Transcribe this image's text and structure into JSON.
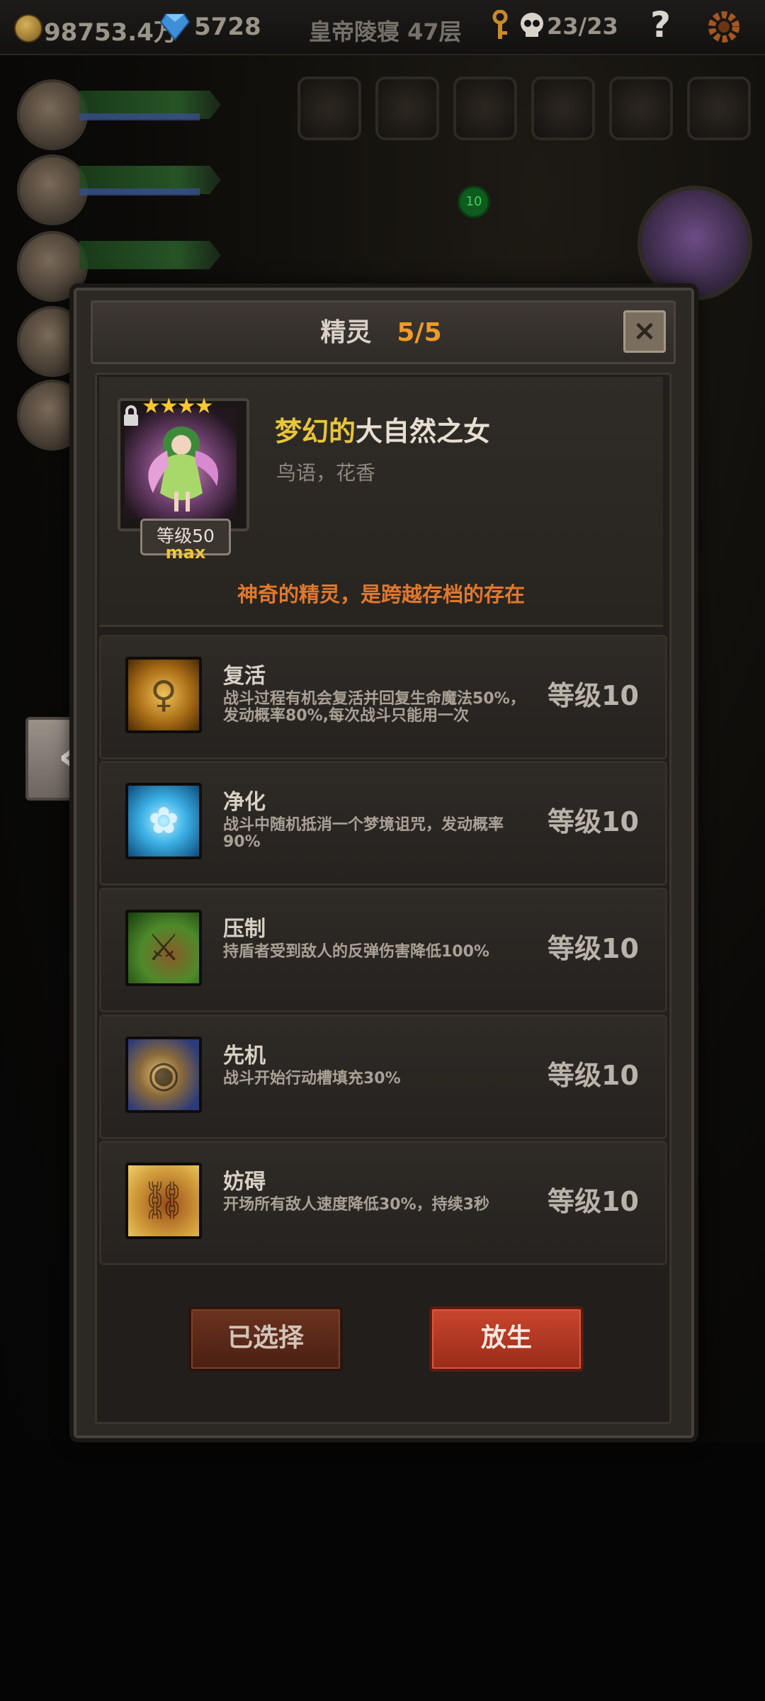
{
  "topbar": {
    "gold": "98753.4万",
    "gems": "5728",
    "location": "皇帝陵寝 47层",
    "kills": "23/23",
    "help_icon": "?"
  },
  "dialog": {
    "title": "精灵",
    "count": "5/5",
    "close_icon": "×"
  },
  "spirit": {
    "stars": "★★★★",
    "level_label": "等级50",
    "level_max": "max",
    "name_prefix": "梦幻的",
    "name_main": "大自然之女",
    "subtitle": "鸟语，花香",
    "description": "神奇的精灵，是跨越存档的存在"
  },
  "skills": [
    {
      "name": "复活",
      "desc": "战斗过程有机会复活并回复生命魔法50%，发动概率80%,每次战斗只能用一次",
      "level": "等级10",
      "icon": "revive-icon"
    },
    {
      "name": "净化",
      "desc": "战斗中随机抵消一个梦境诅咒，发动概率90%",
      "level": "等级10",
      "icon": "purify-flower-icon"
    },
    {
      "name": "压制",
      "desc": "持盾者受到敌人的反弹伤害降低100%",
      "level": "等级10",
      "icon": "suppress-icon"
    },
    {
      "name": "先机",
      "desc": "战斗开始行动槽填充30%",
      "level": "等级10",
      "icon": "leopard-icon"
    },
    {
      "name": "妨碍",
      "desc": "开场所有敌人速度降低30%，持续3秒",
      "level": "等级10",
      "icon": "chained-boot-icon"
    }
  ],
  "buttons": {
    "selected": "已选择",
    "release": "放生"
  },
  "scene": {
    "badge_number": "10"
  },
  "colors": {
    "accent_orange": "#f09a28",
    "name_gold": "#e7c53a",
    "desc_orange": "#e0782d",
    "release_red": "#c9452c"
  }
}
